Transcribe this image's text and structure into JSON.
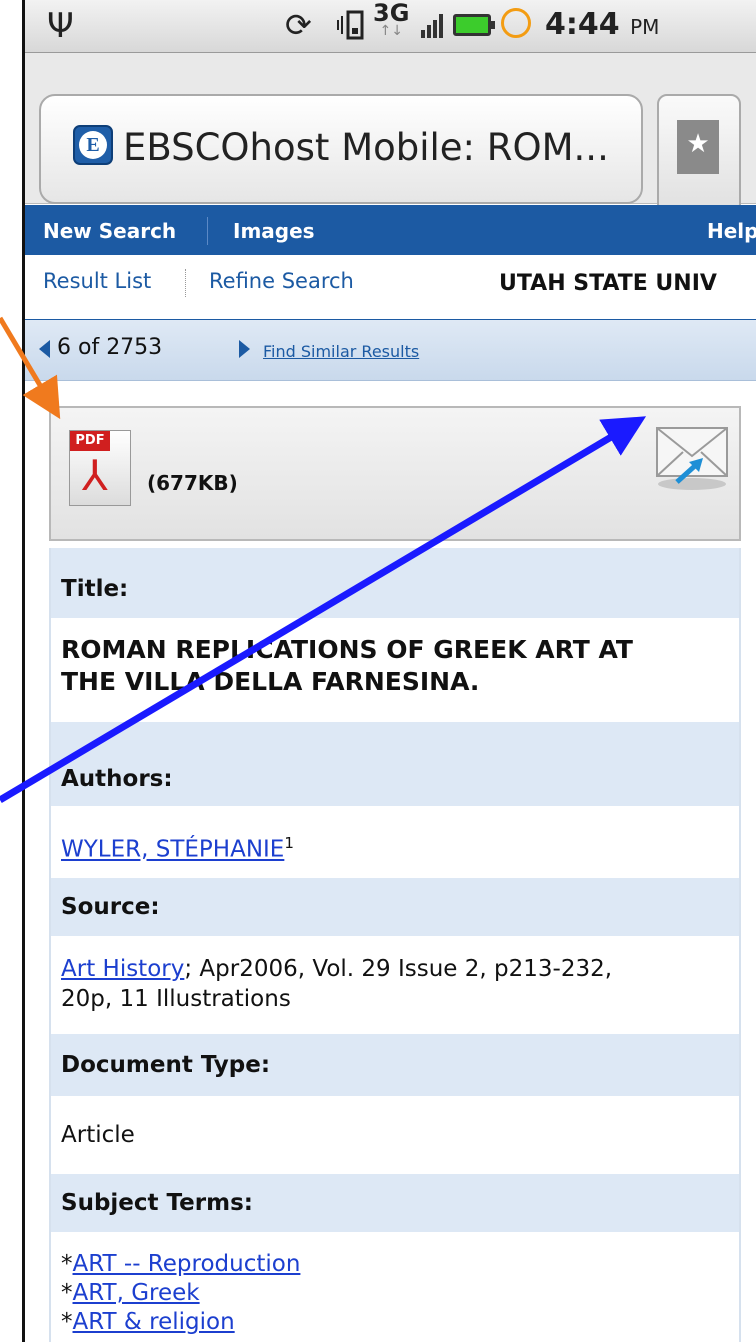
{
  "status_bar": {
    "network": "3G",
    "time": "4:44",
    "ampm": "PM",
    "icons": [
      "usb-icon",
      "sync-icon",
      "vibrate-icon",
      "signal-icon",
      "battery-icon",
      "alarm-icon"
    ]
  },
  "browser": {
    "page_title": "EBSCOhost Mobile: ROM...",
    "favicon_letter": "E",
    "bookmark_icon": "star-bookmark-icon"
  },
  "top_nav": {
    "new_search": "New Search",
    "images": "Images",
    "help": "Help"
  },
  "sub_nav": {
    "result_list": "Result List",
    "refine_search": "Refine Search",
    "institution": "UTAH STATE UNIV"
  },
  "result_nav": {
    "position": "6 of 2753",
    "find_similar": "Find Similar Results"
  },
  "pdf": {
    "badge": "PDF",
    "size": "(677KB)"
  },
  "record": {
    "title_label": "Title:",
    "title_value_line1": "ROMAN REPLICATIONS OF GREEK ART AT",
    "title_value_line2": "THE VILLA DELLA FARNESINA.",
    "authors_label": "Authors:",
    "author": "WYLER, STÉPHANIE",
    "author_sup": "1",
    "source_label": "Source:",
    "source_link": "Art History",
    "source_rest": "; Apr2006, Vol. 29 Issue 2, p213-232,",
    "source_line2": "20p, 11 Illustrations",
    "doctype_label": "Document Type:",
    "doctype_value": "Article",
    "subjects_label": "Subject Terms:",
    "subjects": [
      "ART -- Reproduction",
      "ART, Greek",
      "ART & religion"
    ]
  },
  "colors": {
    "nav_blue": "#1c5aa3",
    "label_bg": "#dde8f5",
    "arrow_orange": "#f07a1e",
    "arrow_blue": "#1a1aff"
  }
}
